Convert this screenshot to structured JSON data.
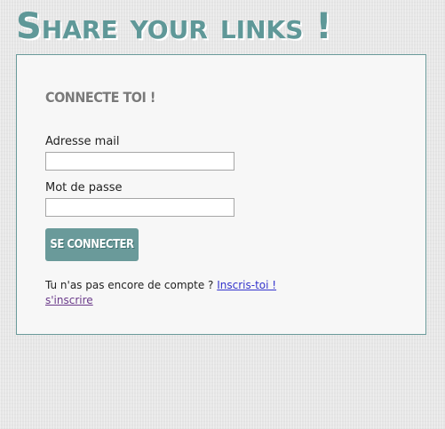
{
  "header": {
    "title": "Share your links !"
  },
  "login": {
    "heading": "Connecte toi !",
    "email_label": "Adresse mail",
    "email_value": "",
    "password_label": "Mot de passe",
    "password_value": "",
    "submit_label": "Se connecter"
  },
  "signup": {
    "prompt": "Tu n'as pas encore de compte ? ",
    "link_label": "Inscris-toi !",
    "alt_link_label": "s'inscrire"
  },
  "colors": {
    "accent": "#6a9a9a",
    "title": "#5f9898",
    "link": "#3333cc",
    "visited_link": "#6a3a8a"
  }
}
